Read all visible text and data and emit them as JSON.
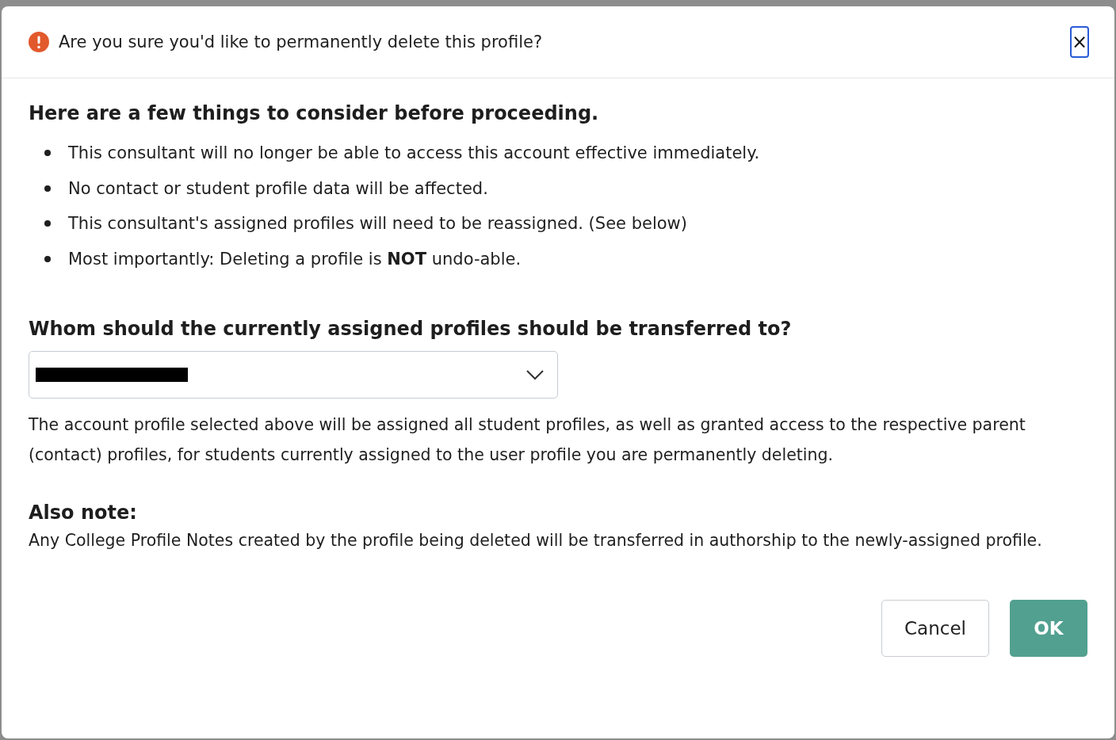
{
  "dialog": {
    "title": "Are you sure you'd like to permanently delete this profile?",
    "close": "×",
    "considerations": {
      "heading": "Here are a few things to consider before proceeding.",
      "items": [
        "This consultant will no longer be able to access this account effective immediately.",
        "No contact or student profile data will be affected.",
        "This consultant's assigned profiles will need to be reassigned. (See below)",
        "Most importantly: Deleting a profile is **NOT** undo-able."
      ]
    },
    "transfer": {
      "question": "Whom should the currently assigned profiles should be transferred to?",
      "value_redacted": true,
      "help": "The account profile selected above will be assigned all student profiles, as well as granted access to the respective parent (contact) profiles, for students currently assigned to the user profile you are permanently deleting."
    },
    "note": {
      "heading": "Also note:",
      "text": "Any College Profile Notes created by the profile being deleted will be transferred in authorship to the newly-assigned profile."
    },
    "buttons": [
      {
        "label": "Cancel",
        "kind": "secondary"
      },
      {
        "label": "OK",
        "kind": "primary"
      }
    ]
  }
}
